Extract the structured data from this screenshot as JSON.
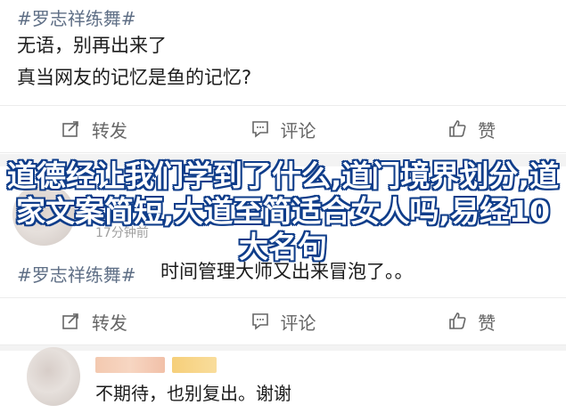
{
  "post1": {
    "hashtag": "#罗志祥练舞#",
    "line1": "无语，别再出来了",
    "line2": "真当网友的记忆是鱼的记忆?"
  },
  "actions1": {
    "repost": "转发",
    "comment": "评论",
    "like": "赞"
  },
  "overlay_title": "道德经让我们学到了什么,道门境界划分,道家文案简短,大道至简适合女人吗,易经10大名句",
  "post2": {
    "time": "17分钟前",
    "hashtag": "#罗志祥练舞#",
    "text": "时间管理大师又出来冒泡了。。"
  },
  "actions2": {
    "repost": "转发",
    "comment": "评论",
    "like": "赞"
  },
  "comment": {
    "text": "不期待，也别复出。谢谢"
  },
  "colors": {
    "hashtag": "#5f6f86",
    "overlay_stroke": "#0f3d8a",
    "icon": "#666666"
  }
}
